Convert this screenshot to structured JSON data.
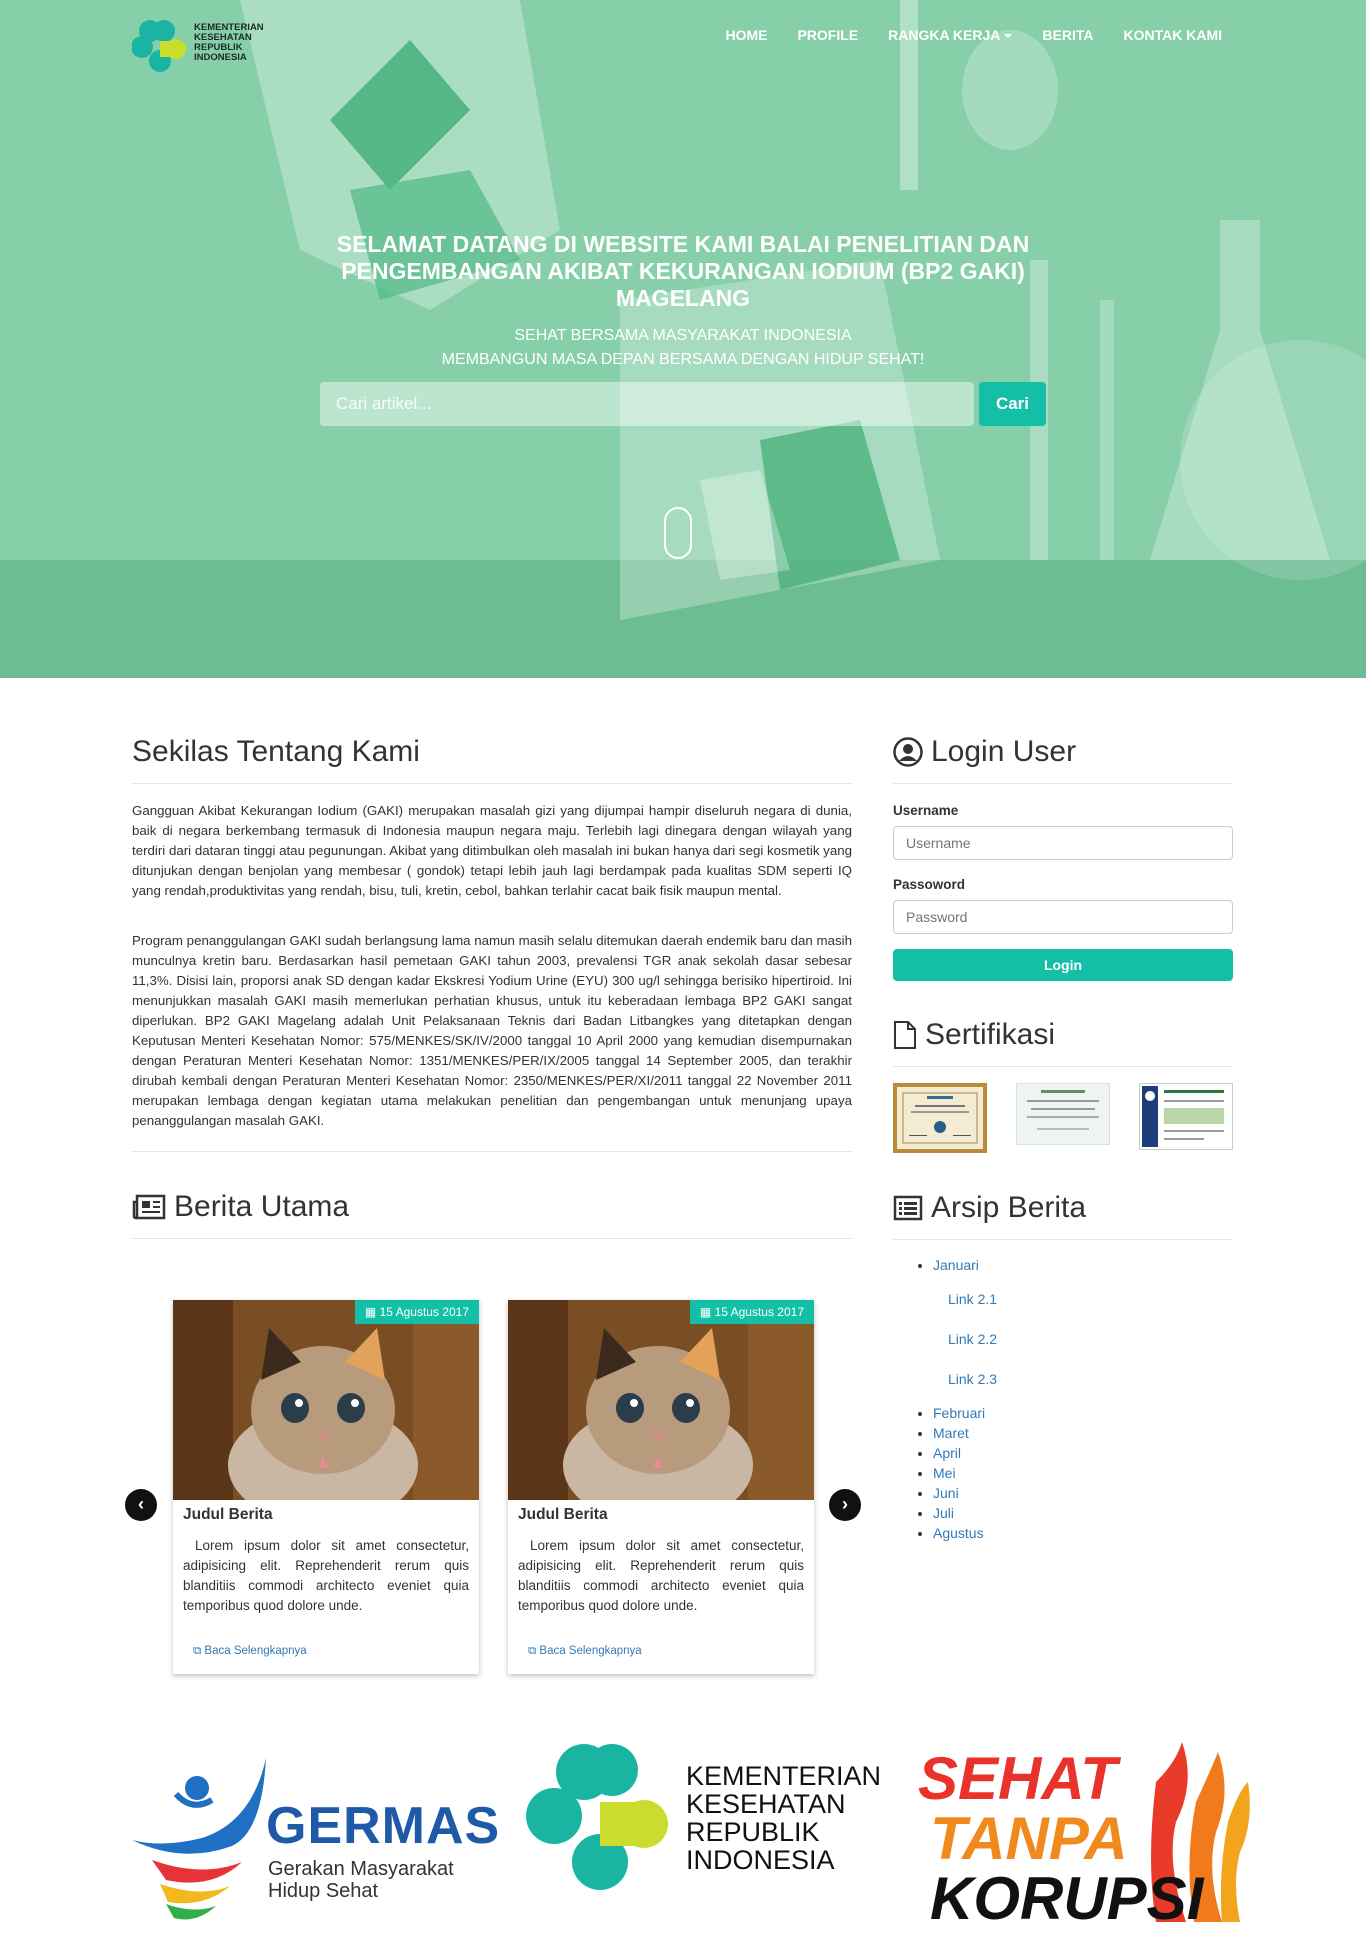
{
  "header": {
    "logo_text": "KEMENTERIAN KESEHATAN REPUBLIK INDONESIA",
    "nav": [
      {
        "label": "HOME"
      },
      {
        "label": "PROFILE"
      },
      {
        "label": "RANGKA KERJA"
      },
      {
        "label": "BERITA"
      },
      {
        "label": "KONTAK KAMI"
      }
    ]
  },
  "hero": {
    "title": "SELAMAT DATANG DI WEBSITE KAMI BALAI PENELITIAN DAN PENGEMBANGAN AKIBAT KEKURANGAN IODIUM (BP2 GAKI) MAGELANG",
    "subtitle_1": "SEHAT BERSAMA MASYARAKAT INDONESIA",
    "subtitle_2": "MEMBANGUN MASA DEPAN BERSAMA DENGAN HIDUP SEHAT!",
    "search_placeholder": "Cari artikel...",
    "search_button": "Cari"
  },
  "about": {
    "heading": "Sekilas Tentang Kami",
    "paragraph_1": "Gangguan Akibat Kekurangan Iodium (GAKI) merupakan masalah gizi yang dijumpai hampir diseluruh negara di dunia, baik di negara berkembang termasuk di Indonesia maupun negara maju. Terlebih lagi dinegara dengan wilayah yang terdiri dari dataran tinggi atau pegunungan. Akibat yang ditimbulkan oleh masalah ini bukan hanya dari segi kosmetik yang ditunjukan dengan benjolan yang membesar ( gondok) tetapi lebih jauh lagi berdampak pada kualitas SDM seperti IQ yang rendah,produktivitas yang rendah, bisu, tuli, kretin, cebol, bahkan terlahir cacat baik fisik maupun mental.",
    "paragraph_2": "Program penanggulangan GAKI sudah berlangsung lama namun masih selalu ditemukan daerah endemik baru dan masih munculnya kretin baru. Berdasarkan hasil pemetaan GAKI tahun 2003, prevalensi TGR anak sekolah dasar sebesar 11,3%. Disisi lain, proporsi anak SD dengan kadar Ekskresi Yodium Urine (EYU) 300 ug/l sehingga berisiko hipertiroid. Ini menunjukkan masalah GAKI masih memerlukan perhatian khusus, untuk itu keberadaan lembaga BP2 GAKI sangat diperlukan. BP2 GAKI Magelang adalah Unit Pelaksanaan Teknis dari Badan Litbangkes yang ditetapkan dengan Keputusan Menteri Kesehatan Nomor: 575/MENKES/SK/IV/2000 tanggal 10 April 2000 yang kemudian disempurnakan dengan Peraturan Menteri Kesehatan Nomor: 1351/MENKES/PER/IX/2005 tanggal 14 September 2005, dan terakhir dirubah kembali dengan Peraturan Menteri Kesehatan Nomor: 2350/MENKES/PER/XI/2011 tanggal 22 November 2011 merupakan lembaga dengan kegiatan utama melakukan penelitian dan pengembangan untuk menunjang upaya penanggulangan masalah GAKI."
  },
  "login": {
    "heading": "Login User",
    "username_label": "Username",
    "username_placeholder": "Username",
    "password_label": "Passoword",
    "password_placeholder": "Password",
    "button": "Login"
  },
  "sertifikasi": {
    "heading": "Sertifikasi"
  },
  "berita": {
    "heading": "Berita Utama",
    "cards": [
      {
        "date": "15 Agustus 2017",
        "title": "Judul Berita",
        "body": "Lorem ipsum dolor sit amet consectetur, adipisicing elit. Reprehenderit rerum quis blanditiis commodi architecto eveniet quia temporibus quod dolore unde.",
        "more": "Baca Selengkapnya"
      },
      {
        "date": "15 Agustus 2017",
        "title": "Judul Berita",
        "body": "Lorem ipsum dolor sit amet consectetur, adipisicing elit. Reprehenderit rerum quis blanditiis commodi architecto eveniet quia temporibus quod dolore unde.",
        "more": "Baca Selengkapnya"
      }
    ],
    "prev": "‹",
    "next": "›"
  },
  "arsip": {
    "heading": "Arsip Berita",
    "months": [
      "Januari",
      "Februari",
      "Maret",
      "April",
      "Mei",
      "Juni",
      "Juli",
      "Agustus"
    ],
    "sub_links": [
      "Link 2.1",
      "Link 2.2",
      "Link 2.3"
    ]
  },
  "footer_logos": {
    "germas_title": "GERMAS",
    "germas_sub_1": "Gerakan Masyarakat",
    "germas_sub_2": "Hidup Sehat",
    "kemenkes_1": "KEMENTERIAN",
    "kemenkes_2": "KESEHATAN",
    "kemenkes_3": "REPUBLIK",
    "kemenkes_4": "INDONESIA",
    "stk_1": "SEHAT",
    "stk_2": "TANPA",
    "stk_3": "KORUPSI"
  },
  "colors": {
    "accent": "#14bfa7",
    "hero": "#7fcba3",
    "link": "#337ab7"
  }
}
